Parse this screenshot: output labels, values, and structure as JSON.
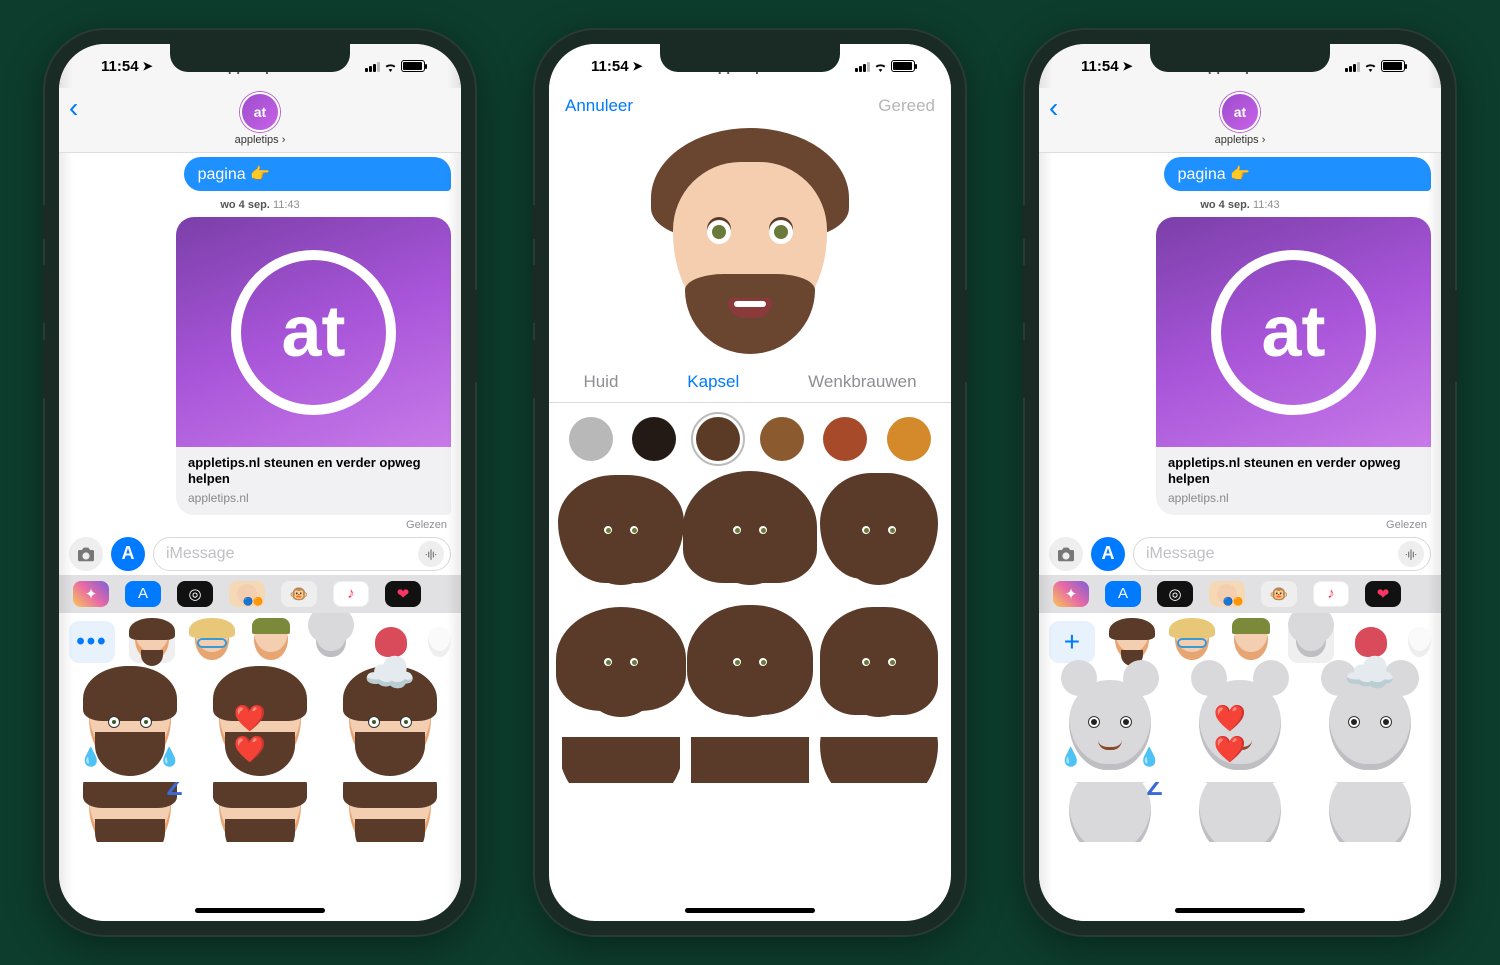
{
  "status": {
    "time": "11:54",
    "overlay_text": "appletips.nl"
  },
  "phone1": {
    "contact_name": "appletips",
    "bubble_text": "pagina 👉",
    "timestamp_day": "wo 4 sep.",
    "timestamp_time": "11:43",
    "attachment_title": "appletips.nl steunen en verder opweg helpen",
    "attachment_domain": "appletips.nl",
    "read_receipt": "Gelezen",
    "compose_placeholder": "iMessage",
    "more_label": "•••"
  },
  "phone2": {
    "cancel": "Annuleer",
    "done": "Gereed",
    "tabs": {
      "skin": "Huid",
      "hair": "Kapsel",
      "brows": "Wenkbrauwen"
    },
    "colors": [
      {
        "hex": "#b8b8b8"
      },
      {
        "hex": "#231a15"
      },
      {
        "hex": "#5c3b26",
        "selected": true
      },
      {
        "hex": "#8c5a2f"
      },
      {
        "hex": "#a64a2a"
      },
      {
        "hex": "#d48a2a"
      }
    ]
  },
  "phone3": {
    "contact_name": "appletips",
    "bubble_text": "pagina 👉",
    "timestamp_day": "wo 4 sep.",
    "timestamp_time": "11:43",
    "attachment_title": "appletips.nl steunen en verder opweg helpen",
    "attachment_domain": "appletips.nl",
    "read_receipt": "Gelezen",
    "compose_placeholder": "iMessage",
    "plus_label": "+"
  }
}
